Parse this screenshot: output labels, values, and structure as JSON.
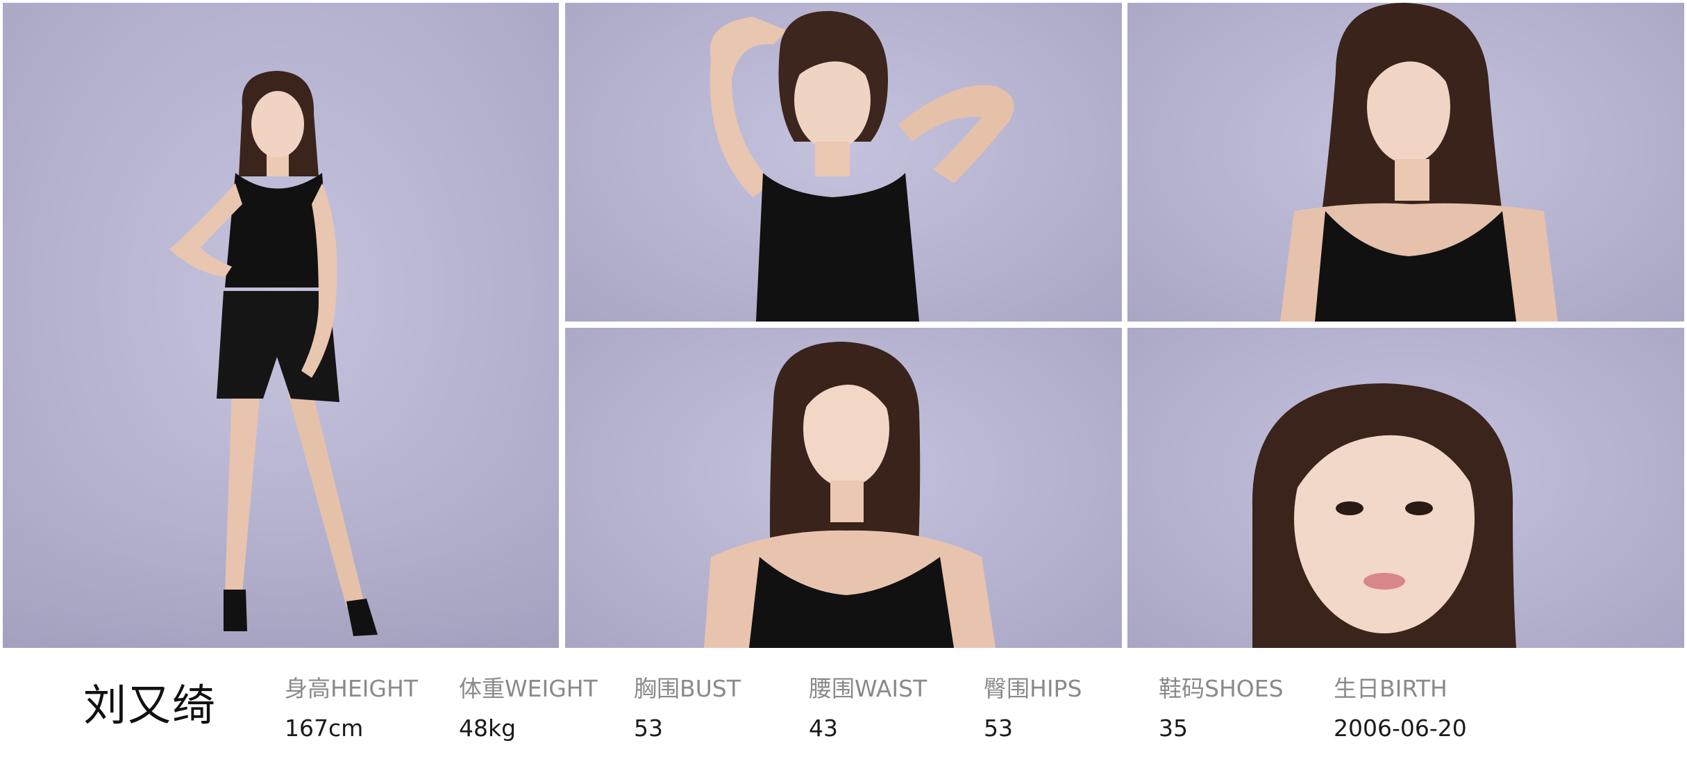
{
  "colors": {
    "backdrop": "#b9b6d2",
    "garment": "#111111",
    "label_text": "#8a8a8a",
    "value_text": "#1a1a1a",
    "name_text": "#111111"
  },
  "photos": [
    {
      "id": "photo-full",
      "pose": "full-body"
    },
    {
      "id": "photo-arms",
      "pose": "arms-raised"
    },
    {
      "id": "photo-side",
      "pose": "three-quarter"
    },
    {
      "id": "photo-front",
      "pose": "front-portrait"
    },
    {
      "id": "photo-close",
      "pose": "close-up"
    }
  ],
  "profile": {
    "name": "刘又绮",
    "stats": [
      {
        "label": "身高HEIGHT",
        "value": "167cm"
      },
      {
        "label": "体重WEIGHT",
        "value": "48kg"
      },
      {
        "label": "胸围BUST",
        "value": "53"
      },
      {
        "label": "腰围WAIST",
        "value": "43"
      },
      {
        "label": "臀围HIPS",
        "value": "53"
      },
      {
        "label": "鞋码SHOES",
        "value": "35"
      },
      {
        "label": "生日BIRTH",
        "value": "2006-06-20"
      }
    ]
  }
}
